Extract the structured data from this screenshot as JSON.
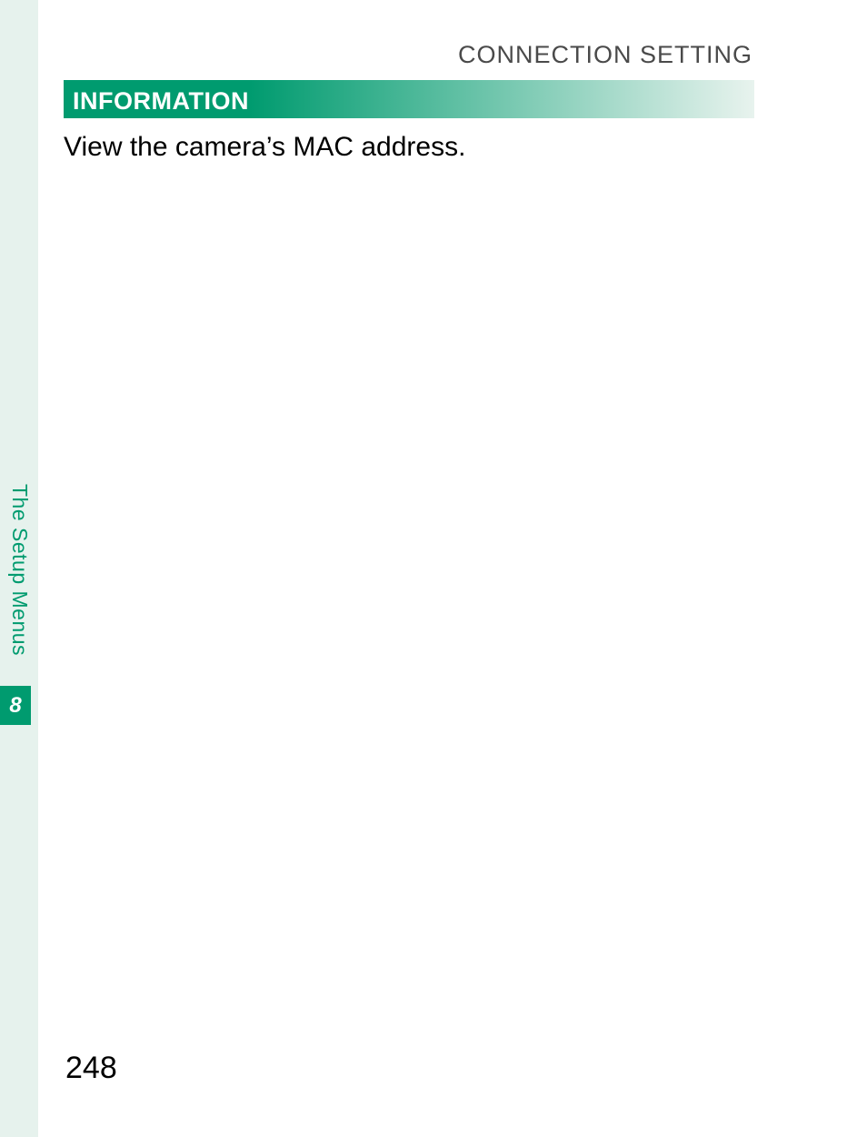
{
  "sidebar": {
    "section_label": "The Setup Menus",
    "chapter_number": "8"
  },
  "header": {
    "breadcrumb": "CONNECTION SETTING"
  },
  "section": {
    "title": "INFORMATION",
    "body": "View the camera’s MAC address."
  },
  "page": {
    "number": "248"
  }
}
